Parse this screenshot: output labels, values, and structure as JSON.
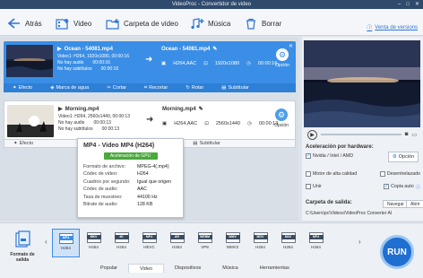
{
  "window": {
    "title": "VideoProc - Convertidor de video"
  },
  "toolbar": {
    "back": "Atrás",
    "video": "Video",
    "video_folder": "Carpeta de video",
    "music": "Música",
    "delete": "Borrar",
    "help_link": "Venta de versions"
  },
  "items": [
    {
      "source_name": "Ocean - 54081.mp4",
      "video_info": "Video1: H264, 1920x1080, 00:00:16",
      "audio_info": "No hay audio",
      "sub_info": "No hay subtítulos",
      "time_a": "00:00:16",
      "time_b": "00:00:16",
      "target_name": "Ocean - 54081.mp4",
      "codec": "H264,AAC",
      "resolution": "1920x1080",
      "duration": "00:00:16",
      "option": "Opción"
    },
    {
      "source_name": "Morning.mp4",
      "video_info": "Video1: H264, 2560x1440, 00:00:13",
      "audio_info": "No hay audio",
      "sub_info": "No hay subtítulos",
      "time_a": "00:00:13",
      "time_b": "00:00:13",
      "target_name": "Morning.mp4",
      "codec": "H264,AAC",
      "resolution": "2560x1440",
      "duration": "00:00:13",
      "option": "Opción"
    }
  ],
  "actions": {
    "effect": "Efecto",
    "watermark": "Marca de agua",
    "cut": "Cortar",
    "crop": "Recortar",
    "rotate": "Rotar",
    "subtitle": "Subtitular"
  },
  "popup": {
    "title": "MP4 - Video MP4 (H264)",
    "gpu": "Aceleración de GPU",
    "rows": [
      {
        "k": "Formato de archivo:",
        "v": "MPEG-4(.mp4)"
      },
      {
        "k": "Códec de video:",
        "v": "H264"
      },
      {
        "k": "Cuadros por segundo:",
        "v": "Igual que origen"
      },
      {
        "k": "Códec de audio:",
        "v": "AAC"
      },
      {
        "k": "Tasa de muestreo:",
        "v": "44100 Hz"
      },
      {
        "k": "Bitrate de audio:",
        "v": "128 KB"
      }
    ]
  },
  "hardware": {
    "title": "Aceleración por hardware:",
    "nvidia": "Nvidia / Intel / AMD",
    "option": "Opción",
    "quality_engine": "Motor de alta calidad",
    "deinterlace": "Desentrelazado",
    "merge": "Unir",
    "copy_auto": "Copia auto",
    "nvidia_checked": true,
    "quality_checked": false,
    "deinterlace_checked": false,
    "merge_checked": false,
    "copy_checked": true
  },
  "output": {
    "label": "Carpeta de salida:",
    "browse": "Navegar",
    "open": "Abrir",
    "path": "C:\\Users\\pc\\Videos\\VideoProc Converter AI"
  },
  "formats": {
    "label": "Formato de salida",
    "items": [
      {
        "tag": "MP4",
        "sub": "H264",
        "selected": true
      },
      {
        "tag": "MKV",
        "sub": "H264",
        "selected": false
      },
      {
        "tag": "4K",
        "sub": "H264",
        "selected": false
      },
      {
        "tag": "MP4",
        "sub": "HEVC",
        "selected": false
      },
      {
        "tag": "AVI",
        "sub": "H264",
        "selected": false
      },
      {
        "tag": "WEBM",
        "sub": "VP8",
        "selected": false
      },
      {
        "tag": "WMV",
        "sub": "WMV2",
        "selected": false
      },
      {
        "tag": "MOV",
        "sub": "H264",
        "selected": false
      },
      {
        "tag": "M4V",
        "sub": "H264",
        "selected": false
      },
      {
        "tag": "MP4",
        "sub": "H264",
        "selected": false
      }
    ]
  },
  "tabs": [
    "Popular",
    "Video",
    "Dispositivos",
    "Música",
    "Herramientas"
  ],
  "active_tab": "Video",
  "run": "RUN",
  "colors": {
    "accent": "#3a8ee6",
    "run": "#1f6fd1",
    "gpu": "#4aa83c"
  }
}
